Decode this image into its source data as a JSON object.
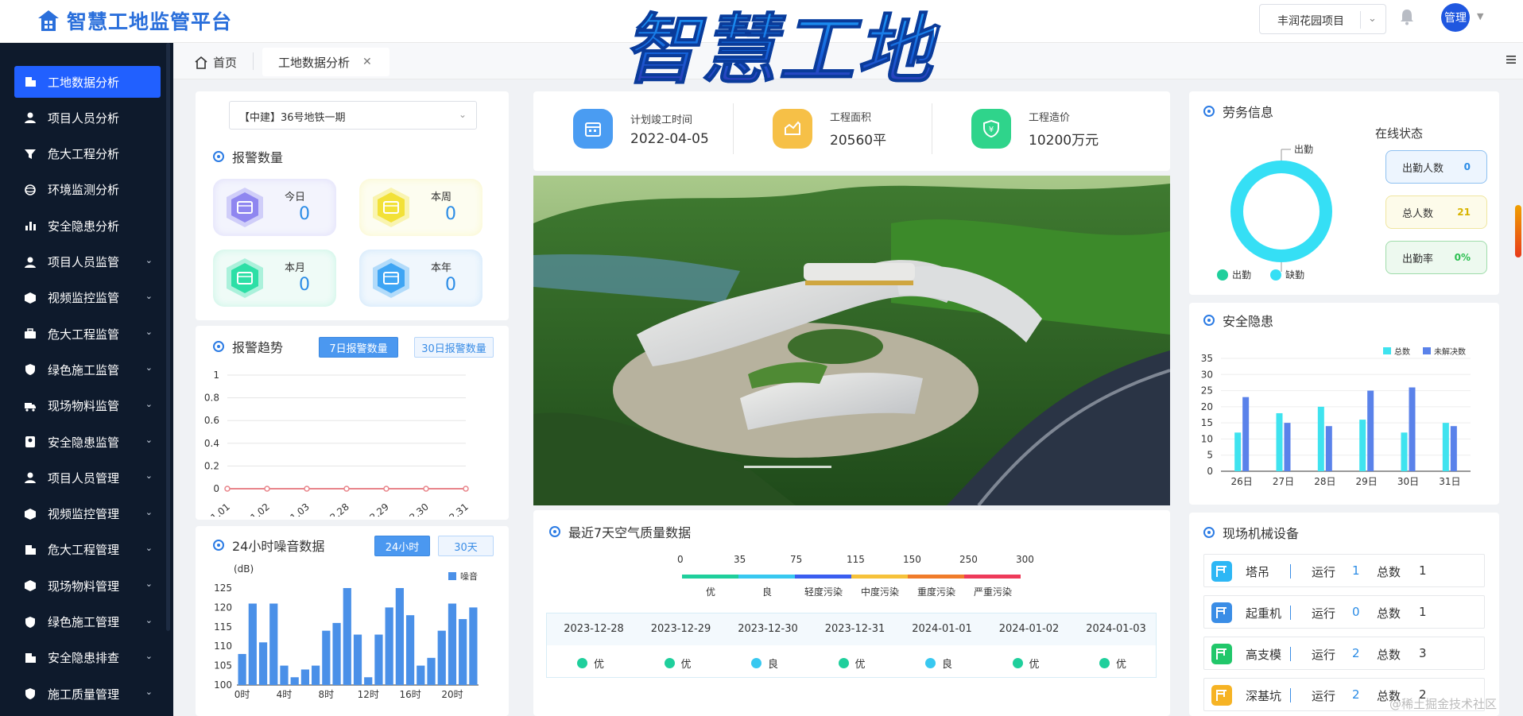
{
  "header": {
    "app_title": "智慧工地监管平台",
    "banner_title": "智慧工地",
    "project_select": "丰润花园项目",
    "user": "管理"
  },
  "sidebar": {
    "items": [
      {
        "label": "工地数据分析",
        "icon": "building-icon",
        "active": true
      },
      {
        "label": "项目人员分析",
        "icon": "user-icon"
      },
      {
        "label": "危大工程分析",
        "icon": "filter-icon"
      },
      {
        "label": "环境监测分析",
        "icon": "globe-icon"
      },
      {
        "label": "安全隐患分析",
        "icon": "bar-chart-icon"
      },
      {
        "label": "项目人员监管",
        "icon": "user-icon",
        "expandable": true
      },
      {
        "label": "视频监控监管",
        "icon": "cube-icon",
        "expandable": true
      },
      {
        "label": "危大工程监管",
        "icon": "toolbox-icon",
        "expandable": true
      },
      {
        "label": "绿色施工监管",
        "icon": "shield-icon",
        "expandable": true
      },
      {
        "label": "现场物料监管",
        "icon": "truck-icon",
        "expandable": true
      },
      {
        "label": "安全隐患监管",
        "icon": "badge-icon",
        "expandable": true
      },
      {
        "label": "项目人员管理",
        "icon": "user-icon",
        "expandable": true
      },
      {
        "label": "视频监控管理",
        "icon": "cube-icon",
        "expandable": true
      },
      {
        "label": "危大工程管理",
        "icon": "building-icon",
        "expandable": true
      },
      {
        "label": "现场物料管理",
        "icon": "cube-icon",
        "expandable": true
      },
      {
        "label": "绿色施工管理",
        "icon": "shield-icon",
        "expandable": true
      },
      {
        "label": "安全隐患排查",
        "icon": "building-icon",
        "expandable": true
      },
      {
        "label": "施工质量管理",
        "icon": "shield-icon",
        "expandable": true
      }
    ]
  },
  "tabs": {
    "home": "首页",
    "active": "工地数据分析"
  },
  "left": {
    "project_select": "【中建】36号地铁一期",
    "alarm_title": "报警数量",
    "alarms": [
      {
        "label": "今日",
        "value": "0",
        "color": "#8f86f0"
      },
      {
        "label": "本周",
        "value": "0",
        "color": "#f2e138"
      },
      {
        "label": "本月",
        "value": "0",
        "color": "#2ddfa6"
      },
      {
        "label": "本年",
        "value": "0",
        "color": "#3fa5f4"
      }
    ],
    "trend_title": "报警趋势",
    "trend_btn_7": "7日报警数量",
    "trend_btn_30": "30日报警数量",
    "noise_title": "24小时噪音数据",
    "noise_btn_24": "24小时",
    "noise_btn_30": "30天"
  },
  "stats": [
    {
      "label": "计划竣工时间",
      "value": "2022-04-05",
      "color": "#4a9cf2",
      "icon": "calendar-icon"
    },
    {
      "label": "工程面积",
      "value": "20560平",
      "color": "#f6c047",
      "icon": "area-chart-icon"
    },
    {
      "label": "工程造价",
      "value": "10200万元",
      "color": "#2fd48b",
      "icon": "yuan-shield-icon"
    }
  ],
  "air_quality": {
    "title": "最近7天空气质量数据",
    "scale": [
      "0",
      "35",
      "75",
      "115",
      "150",
      "250",
      "300"
    ],
    "levels": [
      {
        "label": "优",
        "color": "#1fcf9c"
      },
      {
        "label": "良",
        "color": "#38c8f0"
      },
      {
        "label": "轻度污染",
        "color": "#3a5ef0"
      },
      {
        "label": "中度污染",
        "color": "#f6c23a"
      },
      {
        "label": "重度污染",
        "color": "#f07c2a"
      },
      {
        "label": "严重污染",
        "color": "#ee3a5a"
      }
    ],
    "days": [
      {
        "date": "2023-12-28",
        "grade": "优",
        "color": "#1fcf9c"
      },
      {
        "date": "2023-12-29",
        "grade": "优",
        "color": "#1fcf9c"
      },
      {
        "date": "2023-12-30",
        "grade": "良",
        "color": "#38c8f0"
      },
      {
        "date": "2023-12-31",
        "grade": "优",
        "color": "#1fcf9c"
      },
      {
        "date": "2024-01-01",
        "grade": "良",
        "color": "#38c8f0"
      },
      {
        "date": "2024-01-02",
        "grade": "优",
        "color": "#1fcf9c"
      },
      {
        "date": "2024-01-03",
        "grade": "优",
        "color": "#1fcf9c"
      }
    ]
  },
  "labor": {
    "title": "劳务信息",
    "donut_top_label": "出勤",
    "legend": [
      "出勤",
      "缺勤"
    ],
    "online_title": "在线状态",
    "status": [
      {
        "label": "出勤人数",
        "value": "0",
        "color": "#2b8ce6",
        "bg": "#edf5fe",
        "border": "#8ec0f0"
      },
      {
        "label": "总人数",
        "value": "21",
        "color": "#d8b400",
        "bg": "#fdfbea",
        "border": "#efe6a0"
      },
      {
        "label": "出勤率",
        "value": "0%",
        "color": "#2bbf50",
        "bg": "#edf9ef",
        "border": "#9fdcaa"
      }
    ]
  },
  "hazard": {
    "title": "安全隐患"
  },
  "machines": {
    "title": "现场机械设备",
    "run_label": "运行",
    "total_label": "总数",
    "rows": [
      {
        "name": "塔吊",
        "run": "1",
        "total": "1",
        "color": "#2db7f5",
        "icon": "tower-crane-icon"
      },
      {
        "name": "起重机",
        "run": "0",
        "total": "1",
        "color": "#3a8de6",
        "icon": "crane-icon"
      },
      {
        "name": "高支模",
        "run": "2",
        "total": "3",
        "color": "#21c76a",
        "icon": "formwork-icon"
      },
      {
        "name": "深基坑",
        "run": "2",
        "total": "2",
        "color": "#f6b324",
        "icon": "pit-icon"
      }
    ]
  },
  "watermark": "@稀土掘金技术社区",
  "chart_data": [
    {
      "type": "line",
      "title": "报警趋势",
      "categories": [
        "1.01",
        "1.02",
        "1.03",
        "12.28",
        "12.29",
        "12.30",
        "12.31"
      ],
      "values": [
        0,
        0,
        0,
        0,
        0,
        0,
        0
      ],
      "yticks": [
        "0",
        "0.2",
        "0.4",
        "0.6",
        "0.8",
        "1"
      ],
      "ylim": [
        0,
        1
      ],
      "color": "#e8848a"
    },
    {
      "type": "bar",
      "title": "24小时噪音数据",
      "ylabel": "(dB)",
      "series_name": "噪音",
      "xticks": [
        "0时",
        "4时",
        "8时",
        "12时",
        "16时",
        "20时"
      ],
      "yticks": [
        "100",
        "105",
        "110",
        "115",
        "120",
        "125"
      ],
      "ylim": [
        100,
        125
      ],
      "values": [
        108,
        121,
        111,
        121,
        105,
        102,
        104,
        105,
        114,
        116,
        125,
        113,
        102,
        113,
        120,
        125,
        118,
        105,
        107,
        114,
        121,
        117,
        120
      ],
      "color": "#4a90e8"
    },
    {
      "type": "bar",
      "title": "安全隐患",
      "categories": [
        "26日",
        "27日",
        "28日",
        "29日",
        "30日",
        "31日"
      ],
      "yticks": [
        "0",
        "5",
        "10",
        "15",
        "20",
        "25",
        "30",
        "35"
      ],
      "ylim": [
        0,
        35
      ],
      "series": [
        {
          "name": "总数",
          "values": [
            12,
            18,
            20,
            16,
            12,
            15
          ],
          "color": "#3fe3ef"
        },
        {
          "name": "未解决数",
          "values": [
            23,
            15,
            14,
            25,
            26,
            14
          ],
          "color": "#5a82ea"
        }
      ]
    },
    {
      "type": "pie",
      "title": "劳务信息",
      "series": [
        {
          "name": "出勤",
          "value": 0,
          "color": "#1fcf9c"
        },
        {
          "name": "缺勤",
          "value": 21,
          "color": "#35dff5"
        }
      ]
    }
  ]
}
